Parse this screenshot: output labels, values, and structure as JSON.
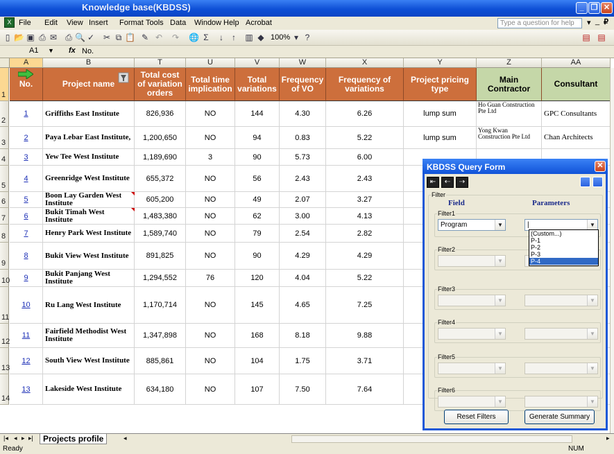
{
  "window": {
    "title": "Knowledge base(KBDSS)"
  },
  "menu": [
    "File",
    "Edit",
    "View",
    "Insert",
    "Format",
    "Tools",
    "Data",
    "Window",
    "Help",
    "Acrobat"
  ],
  "help_placeholder": "Type a question for help",
  "toolbar": {
    "zoom": "100%"
  },
  "formula": {
    "cell_ref": "A1",
    "fx": "fx",
    "content": "No."
  },
  "columns": [
    {
      "letter": "A"
    },
    {
      "letter": "B"
    },
    {
      "letter": "T"
    },
    {
      "letter": "U"
    },
    {
      "letter": "V"
    },
    {
      "letter": "W"
    },
    {
      "letter": "X"
    },
    {
      "letter": "Y"
    },
    {
      "letter": "Z"
    },
    {
      "letter": "AA"
    }
  ],
  "headers": [
    "No.",
    "Project name",
    "Total cost of variation orders",
    "Total time implication",
    "Total variations",
    "Frequency of VO",
    "Frequency of variations",
    "Project pricing type",
    "Main Contractor",
    "Consultant"
  ],
  "rows": [
    {
      "rn": "2",
      "no": "1",
      "name": "Griffiths East Institute",
      "cost": "826,936",
      "time": "NO",
      "var": "144",
      "fvo": "4.30",
      "fvar": "6.26",
      "type": "lump sum",
      "contractor": "Ho Guan Construction Pte Ltd",
      "consultant": "GPC Consultants"
    },
    {
      "rn": "3",
      "no": "2",
      "name": "Paya Lebar East Institute,",
      "cost": "1,200,650",
      "time": "NO",
      "var": "94",
      "fvo": "0.83",
      "fvar": "5.22",
      "type": "lump sum",
      "contractor": "Yong Kwan Construction Pte Ltd",
      "consultant": "Chan Architects"
    },
    {
      "rn": "4",
      "no": "3",
      "name": "Yew Tee West Institute",
      "cost": "1,189,690",
      "time": "3",
      "var": "90",
      "fvo": "5.73",
      "fvar": "6.00",
      "type": "",
      "contractor": "",
      "consultant": ""
    },
    {
      "rn": "5",
      "no": "4",
      "name": "Greenridge West Institute",
      "cost": "655,372",
      "time": "NO",
      "var": "56",
      "fvo": "2.43",
      "fvar": "2.43",
      "type": "",
      "contractor": "",
      "consultant": ""
    },
    {
      "rn": "6",
      "no": "5",
      "name": "Boon Lay Garden West Institute",
      "cost": "605,200",
      "time": "NO",
      "var": "49",
      "fvo": "2.07",
      "fvar": "3.27",
      "type": "",
      "contractor": "",
      "consultant": ""
    },
    {
      "rn": "7",
      "no": "6",
      "name": "Bukit Timah West Institute",
      "cost": "1,483,380",
      "time": "NO",
      "var": "62",
      "fvo": "3.00",
      "fvar": "4.13",
      "type": "",
      "contractor": "",
      "consultant": ""
    },
    {
      "rn": "8",
      "no": "7",
      "name": "Henry Park West Institute",
      "cost": "1,589,740",
      "time": "NO",
      "var": "79",
      "fvo": "2.54",
      "fvar": "2.82",
      "type": "",
      "contractor": "",
      "consultant": ""
    },
    {
      "rn": "9",
      "no": "8",
      "name": "Bukit View West Institute",
      "cost": "891,825",
      "time": "NO",
      "var": "90",
      "fvo": "4.29",
      "fvar": "4.29",
      "type": "",
      "contractor": "",
      "consultant": ""
    },
    {
      "rn": "10",
      "no": "9",
      "name": "Bukit Panjang West Institute",
      "cost": "1,294,552",
      "time": "76",
      "var": "120",
      "fvo": "4.04",
      "fvar": "5.22",
      "type": "",
      "contractor": "",
      "consultant": ""
    },
    {
      "rn": "11",
      "no": "10",
      "name": "Ru Lang West Institute",
      "cost": "1,170,714",
      "time": "NO",
      "var": "145",
      "fvo": "4.65",
      "fvar": "7.25",
      "type": "",
      "contractor": "",
      "consultant": ""
    },
    {
      "rn": "12",
      "no": "11",
      "name": "Fairfield Methodist West Institute",
      "cost": "1,347,898",
      "time": "NO",
      "var": "168",
      "fvo": "8.18",
      "fvar": "9.88",
      "type": "",
      "contractor": "",
      "consultant": ""
    },
    {
      "rn": "13",
      "no": "12",
      "name": "South View West Institute",
      "cost": "885,861",
      "time": "NO",
      "var": "104",
      "fvo": "1.75",
      "fvar": "3.71",
      "type": "",
      "contractor": "",
      "consultant": ""
    },
    {
      "rn": "14",
      "no": "13",
      "name": "Lakeside West Institute",
      "cost": "634,180",
      "time": "NO",
      "var": "107",
      "fvo": "7.50",
      "fvar": "7.64",
      "type": "",
      "contractor": "",
      "consultant": ""
    }
  ],
  "sheet_tab": "Projects profile",
  "status": {
    "left": "Ready",
    "right": "NUM"
  },
  "dialog": {
    "title": "KBDSS Query Form",
    "filter_group": "Filter",
    "field_label": "Field",
    "params_label": "Parameters",
    "filters": [
      {
        "label": "Filter1",
        "field": "Program",
        "param": "|"
      },
      {
        "label": "Filter2",
        "field": "",
        "param": ""
      },
      {
        "label": "Filter3",
        "field": "",
        "param": ""
      },
      {
        "label": "Filter4",
        "field": "",
        "param": ""
      },
      {
        "label": "Filter5",
        "field": "",
        "param": ""
      },
      {
        "label": "Filter6",
        "field": "",
        "param": ""
      }
    ],
    "dropdown_options": [
      "(Custom...)",
      "P-1",
      "P-2",
      "P-3",
      "P-4"
    ],
    "dropdown_selected": "P-4",
    "reset_label": "Reset Filters",
    "generate_label": "Generate Summary"
  }
}
